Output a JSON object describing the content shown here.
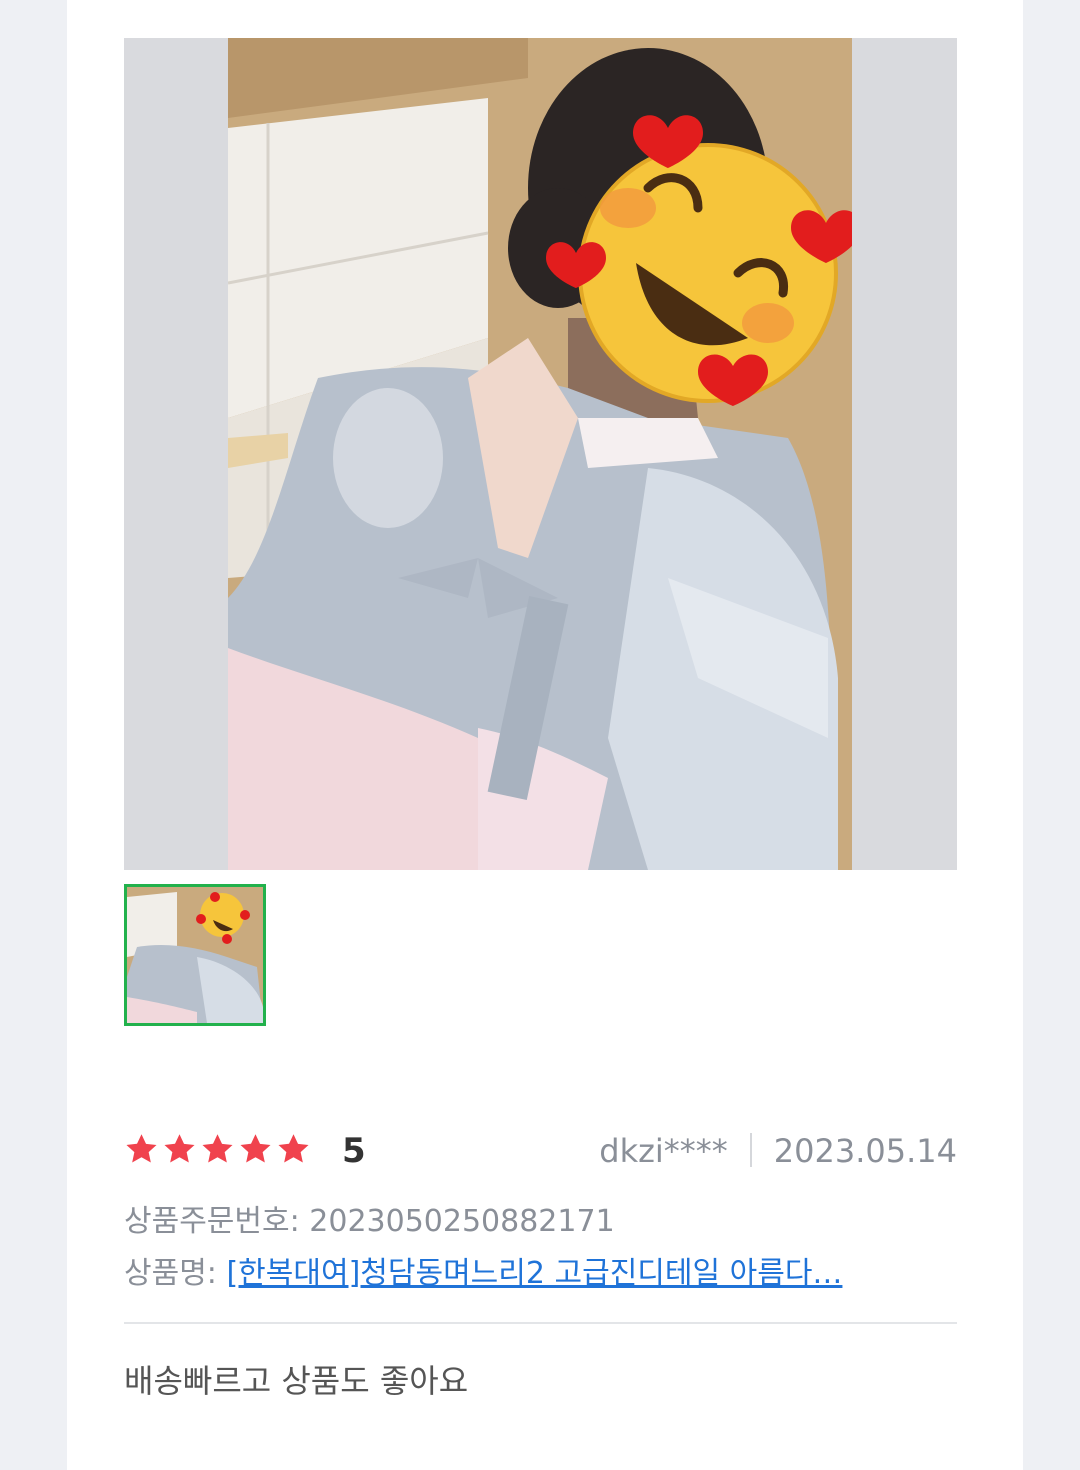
{
  "review": {
    "rating_value": 5,
    "rating_label": "5",
    "author": "dkzi****",
    "date": "2023.05.14",
    "order_label": "상품주문번호:",
    "order_number": "2023050250882171",
    "product_label": "상품명:",
    "product_name": "[한복대여]청담동며느리2 고급진디테일 아름다…",
    "body": "배송빠르고 상품도 좋아요"
  },
  "photo": {
    "alt": "review-photo",
    "thumbnail_selected": true
  },
  "colors": {
    "star": "#f0424d",
    "link": "#1f73d8",
    "thumb_border": "#22b14c",
    "muted_text": "#8a8f98"
  }
}
